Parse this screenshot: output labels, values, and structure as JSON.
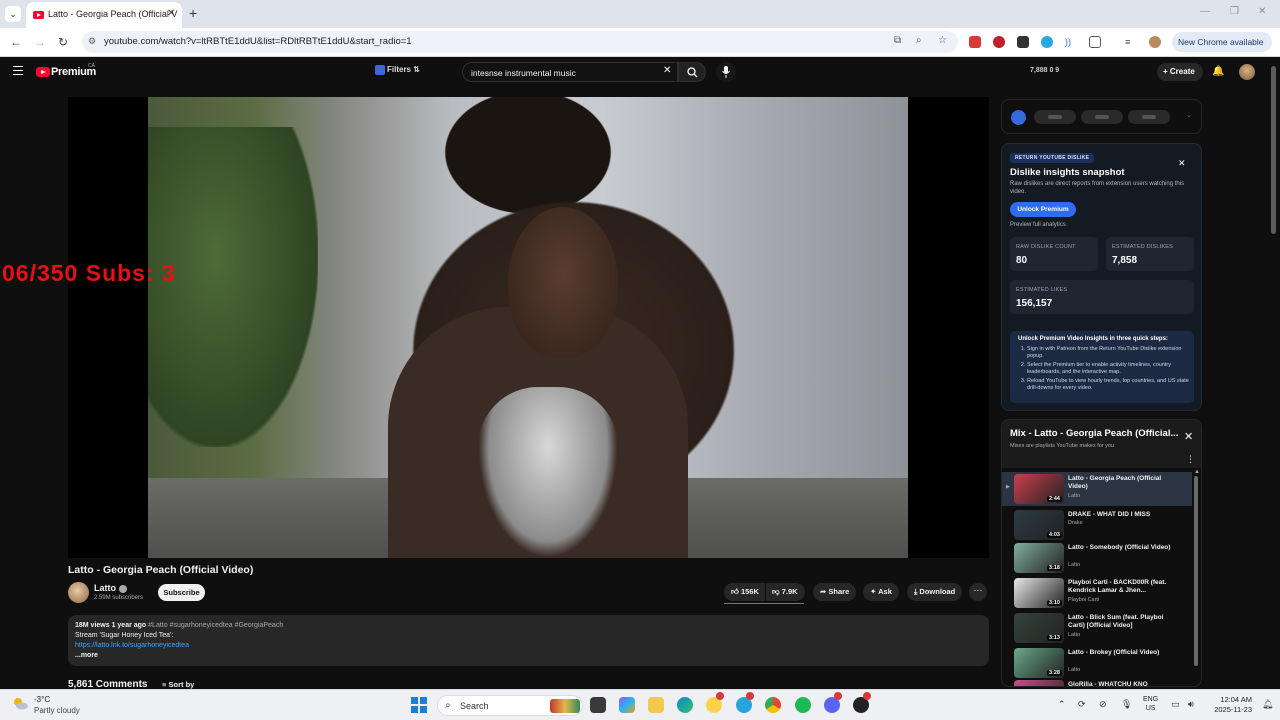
{
  "browser": {
    "tab_title": "Latto - Georgia Peach (Official V",
    "url": "youtube.com/watch?v=ltRBTtE1ddU&list=RDltRBTtE1ddU&start_radio=1",
    "new_chrome": "New Chrome available"
  },
  "masthead": {
    "brand": "Premium",
    "region": "CA",
    "filters": "Filters",
    "search_value": "intesnse instrumental music",
    "stats": "7,888  0  9",
    "create": "Create"
  },
  "player": {
    "overlay": "06/350  Subs: 3"
  },
  "video": {
    "title": "Latto - Georgia Peach (Official Video)",
    "channel": "Latto",
    "subscribers": "2.59M subscribers",
    "subscribe": "Subscribe",
    "likes": "156K",
    "dislikes": "7.9K",
    "share": "Share",
    "ask": "Ask",
    "download": "Download",
    "desc_meta": "18M views  1 year ago",
    "desc_tags": " #Latto #sugarhoneyicedtea #GeorgiaPeach",
    "desc_line2": "Stream 'Sugar Honey Iced Tea':",
    "desc_link": "https://latto.lnk.to/sugarhoneyicedtea",
    "desc_more": "...more",
    "comments": "5,861 Comments",
    "sort_by": "Sort by"
  },
  "dislike_card": {
    "badge": "RETURN YOUTUBE DISLIKE",
    "title": "Dislike insights snapshot",
    "subtitle": "Raw dislikes are direct reports from extension users watching this video.",
    "unlock": "Unlock Premium",
    "preview": "Preview full analytics",
    "raw_label": "RAW DISLIKE COUNT",
    "raw_value": "80",
    "est_dislikes_label": "ESTIMATED DISLIKES",
    "est_dislikes_value": "7,858",
    "est_likes_label": "ESTIMATED LIKES",
    "est_likes_value": "156,157",
    "steps_title": "Unlock Premium Video Insights in three quick steps:",
    "steps": [
      "Sign in with Patreon from the Return YouTube Dislike extension popup.",
      "Select the Premium tier to enable activity timelines, country leaderboards, and the interactive map.",
      "Reload YouTube to view hourly trends, top countries, and US state drill-downs for every video."
    ]
  },
  "playlist": {
    "title": "Mix - Latto - Georgia Peach (Official...",
    "subtitle": "Mixes are playlists YouTube makes for you",
    "items": [
      {
        "title": "Latto - Georgia Peach (Official Video)",
        "artist": "Latto",
        "duration": "2:44",
        "thumb": "#c9404e"
      },
      {
        "title": "DRAKE - WHAT DID I MISS",
        "artist": "Drake",
        "duration": "4:03",
        "thumb": "#2c3a44"
      },
      {
        "title": "Latto - Somebody (Official Video)",
        "artist": "Latto",
        "duration": "3:18",
        "thumb": "#7fae9e"
      },
      {
        "title": "Playboi Carti - BACKD00R (feat. Kendrick Lamar & Jhen...",
        "artist": "Playboi Carti",
        "duration": "3:10",
        "thumb": "#e8e8e8"
      },
      {
        "title": "Latto - Blick Sum (feat. Playboi Carti) [Official Video]",
        "artist": "Latto",
        "duration": "3:13",
        "thumb": "#33453c"
      },
      {
        "title": "Latto - Brokey (Official Video)",
        "artist": "Latto",
        "duration": "3:28",
        "thumb": "#6aa88a"
      },
      {
        "title": "GloRilla - WHATCHU KNO",
        "artist": "",
        "duration": "",
        "thumb": "#c94f8e"
      }
    ]
  },
  "taskbar": {
    "temp": "-3°C",
    "weather": "Partly cloudy",
    "search": "Search",
    "lang1": "ENG",
    "lang2": "US",
    "time": "12:04 AM",
    "date": "2025-11-23"
  }
}
